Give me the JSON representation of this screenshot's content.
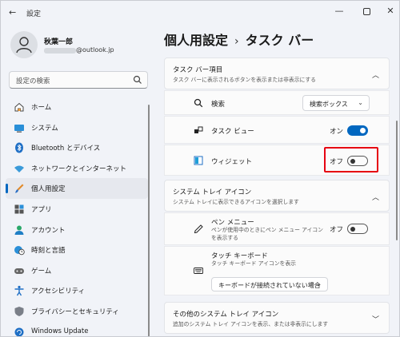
{
  "window": {
    "back": "←",
    "title": "設定",
    "minimize": "—",
    "close": "✕"
  },
  "user": {
    "name": "秋葉一郎",
    "email": "@outlook.jp"
  },
  "search": {
    "placeholder": "設定の検索"
  },
  "nav": [
    {
      "label": "ホーム",
      "icon": "home-icon"
    },
    {
      "label": "システム",
      "icon": "system-icon"
    },
    {
      "label": "Bluetooth とデバイス",
      "icon": "bluetooth-icon"
    },
    {
      "label": "ネットワークとインターネット",
      "icon": "wifi-icon"
    },
    {
      "label": "個人用設定",
      "icon": "brush-icon",
      "active": true
    },
    {
      "label": "アプリ",
      "icon": "apps-icon"
    },
    {
      "label": "アカウント",
      "icon": "account-icon"
    },
    {
      "label": "時刻と言語",
      "icon": "globe-clock-icon"
    },
    {
      "label": "ゲーム",
      "icon": "gamepad-icon"
    },
    {
      "label": "アクセシビリティ",
      "icon": "accessibility-icon"
    },
    {
      "label": "プライバシーとセキュリティ",
      "icon": "shield-icon"
    },
    {
      "label": "Windows Update",
      "icon": "update-icon"
    }
  ],
  "breadcrumb": {
    "parent": "個人用設定",
    "sep": "›",
    "current": "タスク バー"
  },
  "sections": {
    "taskbar_items": {
      "title": "タスク バー項目",
      "subtitle": "タスク バーに表示されるボタンを表示または非表示にする",
      "search": {
        "label": "検索",
        "value": "検索ボックス"
      },
      "task_view": {
        "label": "タスク ビュー",
        "state": "オン"
      },
      "widgets": {
        "label": "ウィジェット",
        "state": "オフ"
      }
    },
    "system_tray": {
      "title": "システム トレイ アイコン",
      "subtitle": "システム トレイに表示できるアイコンを選択します",
      "pen_menu": {
        "label": "ペン メニュー",
        "desc": "ペンが使用中のときにペン メニュー アイコンを表示する",
        "state": "オフ"
      },
      "touch_keyboard": {
        "label": "タッチ キーボード",
        "desc": "タッチ キーボード アイコンを表示",
        "value": "キーボードが接続されていない場合"
      }
    },
    "other_tray": {
      "title": "その他のシステム トレイ アイコン",
      "subtitle": "追加のシステム トレイ アイコンを表示、または非表示にします"
    }
  },
  "colors": {
    "accent": "#0067c0",
    "highlight": "#e60012"
  }
}
